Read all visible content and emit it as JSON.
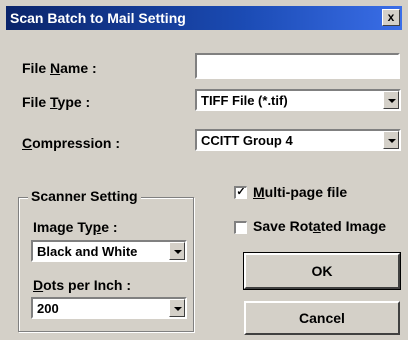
{
  "window": {
    "title": "Scan Batch to Mail Setting",
    "close_glyph": "x"
  },
  "file_name": {
    "label_pre": "File ",
    "label_key": "N",
    "label_post": "ame :",
    "value": ""
  },
  "file_type": {
    "label_pre": "File ",
    "label_key": "T",
    "label_post": "ype :",
    "value": "TIFF File (*.tif)"
  },
  "compression": {
    "label_pre": "",
    "label_key": "C",
    "label_post": "ompression :",
    "value": "CCITT Group 4"
  },
  "scanner_setting": {
    "title": "Scanner Setting",
    "image_type": {
      "label_pre": "Image Ty",
      "label_key": "p",
      "label_post": "e :",
      "value": "Black and White"
    },
    "dpi": {
      "label_pre": "",
      "label_key": "D",
      "label_post": "ots per Inch :",
      "value": "200"
    }
  },
  "multipage": {
    "label_pre": "",
    "label_key": "M",
    "label_post": "ulti-page file",
    "checked": true,
    "mark": "✓"
  },
  "rotated": {
    "label_pre": "Save Rot",
    "label_key": "a",
    "label_post": "ted Image",
    "checked": false,
    "mark": ""
  },
  "buttons": {
    "ok": "OK",
    "cancel": "Cancel"
  }
}
